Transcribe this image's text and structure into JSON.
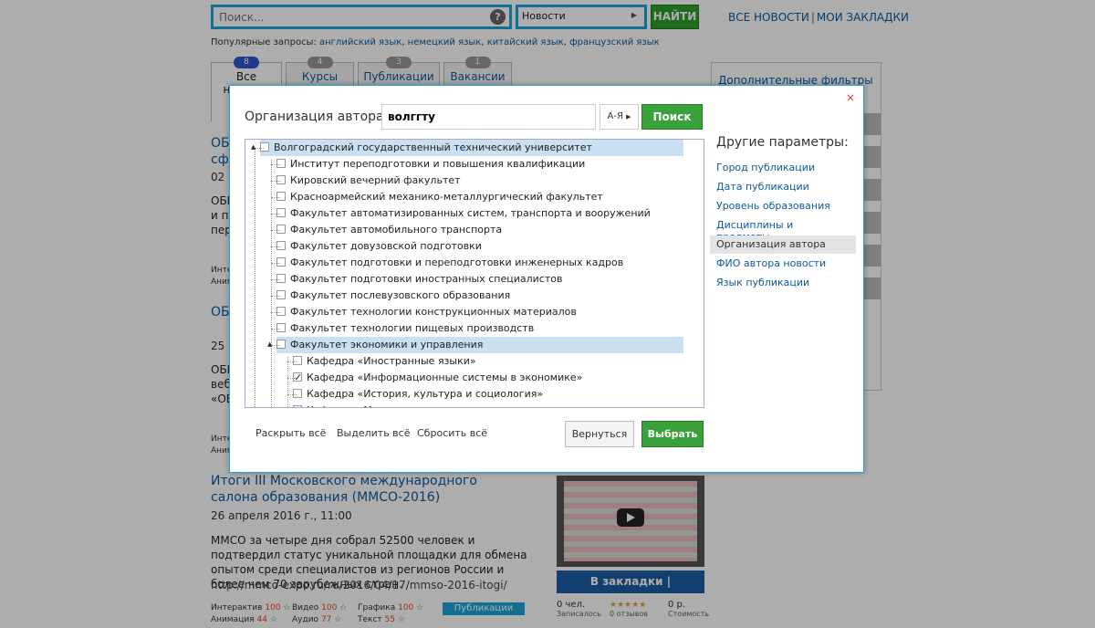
{
  "header": {
    "search_placeholder": "Поиск...",
    "help_glyph": "?",
    "category": "Новости",
    "find_label": "НАЙТИ",
    "all_news": "ВСЕ НОВОСТИ",
    "separator": "|",
    "bookmarks": "МОИ ЗАКЛАДКИ",
    "popular_label": "Популярные запросы:",
    "popular": [
      "английский язык",
      "немецкий язык",
      "китайский язык",
      "французский язык"
    ]
  },
  "tabs": [
    {
      "label": "Все новости",
      "count": "8"
    },
    {
      "label": "Курсы",
      "count": "4"
    },
    {
      "label": "Публикации",
      "count": "3"
    },
    {
      "label": "Вакансии",
      "count": "1"
    }
  ],
  "right_panel": {
    "title": "Дополнительные фильтры"
  },
  "background_fragments": {
    "a1_title": "ОБР\nсфе",
    "a1_date": "02 и",
    "a1_text": "ОБР\nи пу\nпер",
    "a1_stats": "Интер\nАним",
    "a2_title": "ОБР",
    "a2_date": "25 и",
    "a2_text": "ОБР\nвеб\n«ОБ",
    "a2_stats": "Интер\nАним"
  },
  "article": {
    "title": "Итоги III Московского международного салона образования (ММСО-2016)",
    "date": "26 апреля 2016 г., 11:00",
    "text": "ММСО за четыре дня собрал 52500 человек и подтвердил статус уникальной площадки для обмена опытом среди специалистов из регионов России и более чем 70 зарубежных стран.",
    "url": "http://mmco-expo.ru/ru/2016/04/17/mmso-2016-itogi/",
    "stats": [
      {
        "label": "Интерактив",
        "value": "100"
      },
      {
        "label": "Видео",
        "value": "100"
      },
      {
        "label": "Графика",
        "value": "100"
      },
      {
        "label": "Анимация",
        "value": "44"
      },
      {
        "label": "Аудио",
        "value": "77"
      },
      {
        "label": "Текст",
        "value": "55"
      }
    ],
    "tag": "Публикации",
    "actions": "В закладки  |  Комментарий",
    "enrolled": "0 чел.",
    "enrolled_label": "Записалось",
    "reviews_label": "0 отзывов",
    "price": "0 р.",
    "price_label": "Стоимость"
  },
  "modal": {
    "close": "×",
    "label": "Организация автора:",
    "query": "волггту",
    "sort": "А-Я",
    "search_btn": "Поиск",
    "tree": [
      {
        "label": "Волгоградский государственный технический университет",
        "level": 0,
        "checked": false,
        "highlight": true
      },
      {
        "label": "Институт переподготовки и повышения квалификации",
        "level": 1,
        "checked": false
      },
      {
        "label": "Кировский вечерний факультет",
        "level": 1,
        "checked": false
      },
      {
        "label": "Красноармейский механико-металлургический факультет",
        "level": 1,
        "checked": false
      },
      {
        "label": "Факультет автоматизированных систем, транспорта и вооружений",
        "level": 1,
        "checked": false
      },
      {
        "label": "Факультет автомобильного транспорта",
        "level": 1,
        "checked": false
      },
      {
        "label": "Факультет довузовской подготовки",
        "level": 1,
        "checked": false
      },
      {
        "label": "Факультет подготовки и переподготовки инженерных кадров",
        "level": 1,
        "checked": false
      },
      {
        "label": "Факультет подготовки иностранных специалистов",
        "level": 1,
        "checked": false
      },
      {
        "label": "Факультет послевузовского образования",
        "level": 1,
        "checked": false
      },
      {
        "label": "Факультет технологии конструкционных материалов",
        "level": 1,
        "checked": false
      },
      {
        "label": "Факультет технологии пищевых производств",
        "level": 1,
        "checked": false
      },
      {
        "label": "Факультет экономики и управления",
        "level": 1,
        "checked": false,
        "highlight": true
      },
      {
        "label": "Кафедра «Иностранные языки»",
        "level": 2,
        "checked": false
      },
      {
        "label": "Кафедра «Информационные системы в экономике»",
        "level": 2,
        "checked": true
      },
      {
        "label": "Кафедра «История, культура и социология»",
        "level": 2,
        "checked": false
      },
      {
        "label": "Кафедра «М",
        "level": 2,
        "checked": false
      }
    ],
    "side_title": "Другие параметры:",
    "side_items": [
      "Город публикации",
      "Дата публикации",
      "Уровень образования",
      "Дисциплины и предметы",
      "Организация автора",
      "ФИО автора новости",
      "Язык публикации"
    ],
    "side_active": 4,
    "expand_all": "Раскрыть всё",
    "select_all": "Выделить всё",
    "reset_all": "Сбросить всё",
    "back": "Вернуться",
    "choose": "Выбрать"
  }
}
